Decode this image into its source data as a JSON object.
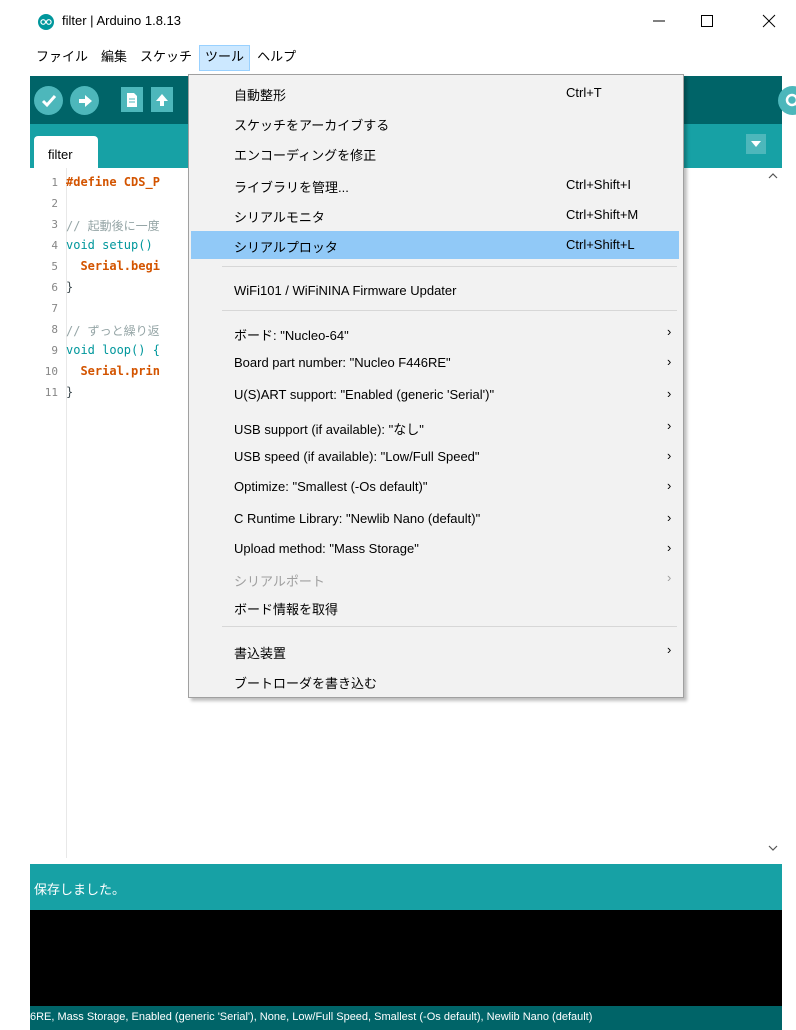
{
  "window": {
    "title": "filter | Arduino 1.8.13",
    "minimize_glyph": "—",
    "maximize_glyph": "☐",
    "close_glyph": "✕"
  },
  "menubar": {
    "items": [
      {
        "label": "ファイル"
      },
      {
        "label": "編集"
      },
      {
        "label": "スケッチ"
      },
      {
        "label": "ツール",
        "active": true
      },
      {
        "label": "ヘルプ"
      }
    ]
  },
  "toolbar": {
    "buttons": [
      "verify-icon",
      "upload-icon",
      "new-icon",
      "open-icon",
      "save-icon",
      "serial-monitor-icon"
    ]
  },
  "tabs": {
    "active": "filter"
  },
  "editor": {
    "line_numbers": [
      "1",
      "2",
      "3",
      "4",
      "5",
      "6",
      "7",
      "8",
      "9",
      "10",
      "11"
    ],
    "lines": [
      "#define CDS_P",
      "",
      "// 起動後に一度",
      "void setup()",
      "  Serial.begi",
      "}",
      "",
      "// ずっと繰り返",
      "void loop() {",
      "  Serial.prin",
      "}"
    ]
  },
  "status": {
    "message": "保存しました。"
  },
  "footer": {
    "text": "6RE, Mass Storage, Enabled (generic 'Serial'), None, Low/Full Speed, Smallest (-Os default), Newlib Nano (default)"
  },
  "tools_menu": {
    "items": [
      {
        "label": "自動整形",
        "shortcut": "Ctrl+T"
      },
      {
        "label": "スケッチをアーカイブする",
        "shortcut": ""
      },
      {
        "label": "エンコーディングを修正",
        "shortcut": ""
      },
      {
        "label": "ライブラリを管理...",
        "shortcut": "Ctrl+Shift+I"
      },
      {
        "label": "シリアルモニタ",
        "shortcut": "Ctrl+Shift+M"
      },
      {
        "label": "シリアルプロッタ",
        "shortcut": "Ctrl+Shift+L",
        "highlighted": true
      },
      {
        "label": "WiFi101 / WiFiNINA Firmware Updater",
        "shortcut": ""
      },
      {
        "label": "ボード: \"Nucleo-64\"",
        "submenu": true
      },
      {
        "label": "Board part number: \"Nucleo F446RE\"",
        "submenu": true
      },
      {
        "label": "U(S)ART support: \"Enabled (generic 'Serial')\"",
        "submenu": true
      },
      {
        "label": "USB support (if available): \"なし\"",
        "submenu": true
      },
      {
        "label": "USB speed (if available): \"Low/Full Speed\"",
        "submenu": true
      },
      {
        "label": "Optimize: \"Smallest (-Os default)\"",
        "submenu": true
      },
      {
        "label": "C Runtime Library: \"Newlib Nano (default)\"",
        "submenu": true
      },
      {
        "label": "Upload method: \"Mass Storage\"",
        "submenu": true
      },
      {
        "label": "シリアルポート",
        "submenu": true,
        "disabled": true
      },
      {
        "label": "ボード情報を取得",
        "shortcut": ""
      },
      {
        "label": "書込装置",
        "submenu": true
      },
      {
        "label": "ブートローダを書き込む",
        "shortcut": ""
      }
    ],
    "submenu_arrow": "›"
  },
  "colors": {
    "toolbar": "#006468",
    "tabstrip": "#17a1a5",
    "button": "#4db7bb",
    "highlight": "#91c9f7"
  }
}
